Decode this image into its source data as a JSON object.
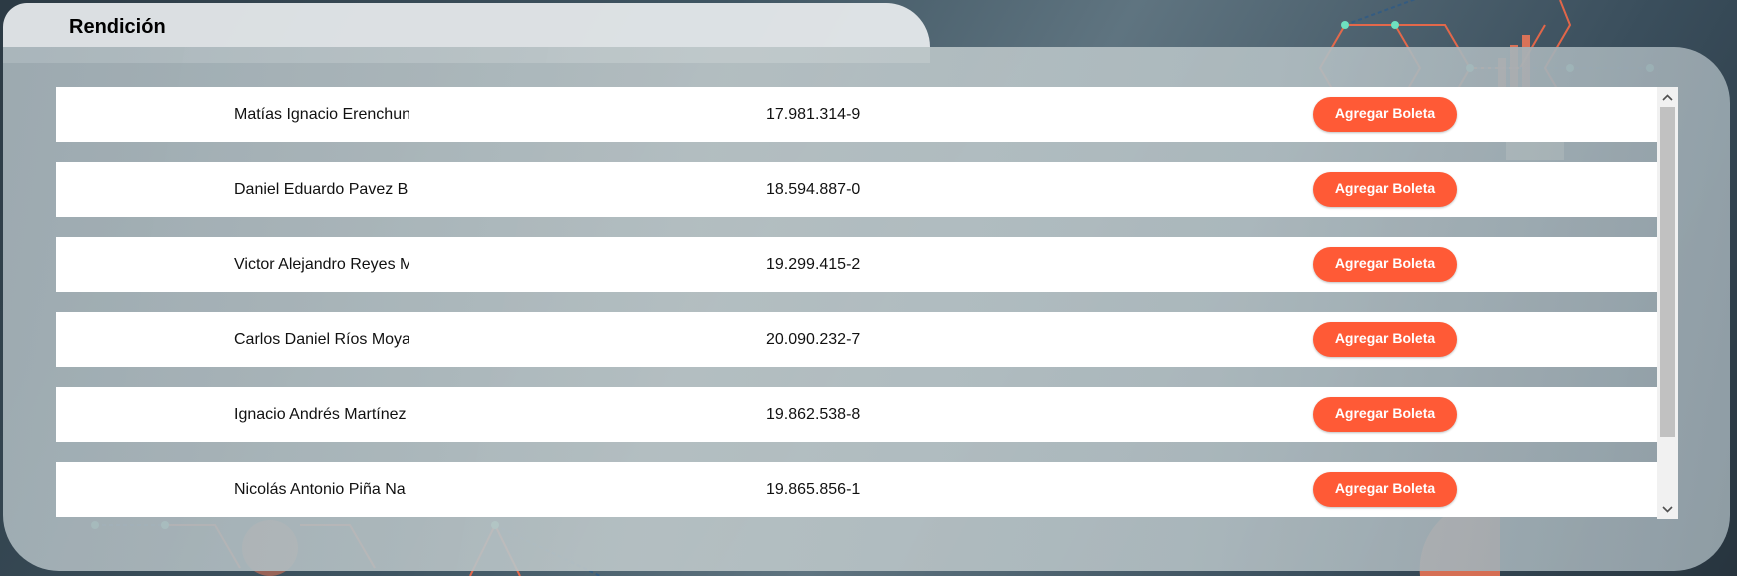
{
  "section": {
    "title": "Rendición"
  },
  "rows": [
    {
      "name": "Matías Ignacio Erenchun",
      "rut": "17.981.314-9",
      "action": "Agregar Boleta"
    },
    {
      "name": "Daniel Eduardo Pavez B",
      "rut": "18.594.887-0",
      "action": "Agregar Boleta"
    },
    {
      "name": "Victor Alejandro Reyes M",
      "rut": "19.299.415-2",
      "action": "Agregar Boleta"
    },
    {
      "name": "Carlos Daniel Ríos Moya",
      "rut": "20.090.232-7",
      "action": "Agregar Boleta"
    },
    {
      "name": "Ignacio Andrés Martínez",
      "rut": "19.862.538-8",
      "action": "Agregar Boleta"
    },
    {
      "name": "Nicolás Antonio Piña Na",
      "rut": "19.865.856-1",
      "action": "Agregar Boleta"
    }
  ],
  "scrollbar": {
    "up_icon": "chevron-up-icon",
    "down_icon": "chevron-down-icon"
  },
  "colors": {
    "accent_button": "#ff5a36",
    "row_bg": "#ffffff",
    "tab_bg": "#e8ecee"
  }
}
